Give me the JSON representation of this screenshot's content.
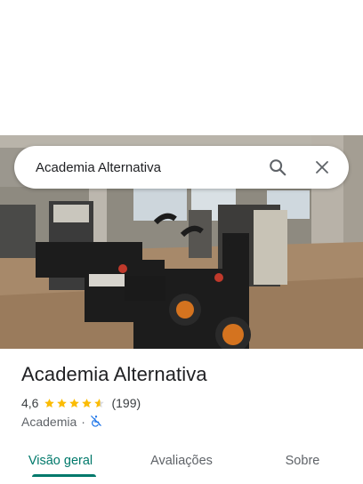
{
  "search": {
    "query": "Academia Alternativa",
    "search_icon": "search-icon",
    "close_icon": "close-icon"
  },
  "place": {
    "name": "Academia Alternativa",
    "rating": "4,6",
    "stars_value": 4.6,
    "review_count": "(199)",
    "category": "Academia",
    "separator": "·",
    "accessibility_icon": "no-wheelchair-icon"
  },
  "tabs": [
    {
      "label": "Visão geral",
      "active": true
    },
    {
      "label": "Avaliações",
      "active": false
    },
    {
      "label": "Sobre",
      "active": false
    }
  ],
  "colors": {
    "accent": "#00796b",
    "star": "#fbbc04",
    "accessibility_icon": "#1a73e8"
  }
}
